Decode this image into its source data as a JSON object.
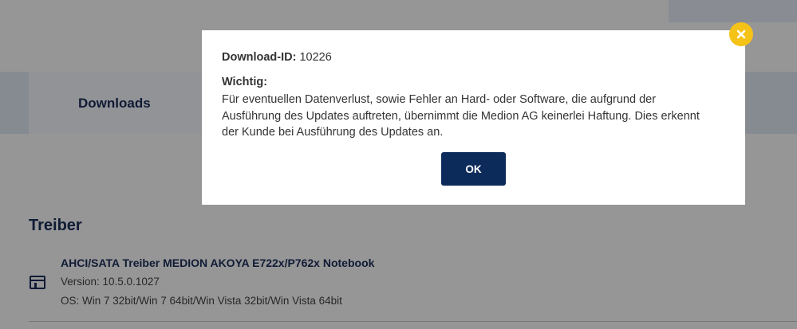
{
  "page": {
    "tab_label": "Downloads",
    "section_title": "Treiber",
    "driver": {
      "title": "AHCI/SATA Treiber MEDION AKOYA E722x/P762x Notebook",
      "version": "Version: 10.5.0.1027",
      "os": "OS: Win 7 32bit/Win 7 64bit/Win Vista 32bit/Win Vista 64bit",
      "icon": "driver-window-icon"
    }
  },
  "modal": {
    "id_label": "Download-ID:",
    "id_value": " 10226",
    "heading": "Wichtig:",
    "body": "Für eventuellen Datenverlust, sowie Fehler an Hard- oder Software, die aufgrund der Ausführung des Updates auftreten, übernimmt die Medion AG keinerlei Haftung. Dies erkennt der Kunde bei Ausführung des Updates an.",
    "ok_label": "OK",
    "close_icon": "close-icon"
  },
  "colors": {
    "brand_navy": "#0d2b5a",
    "close_yellow": "#f5c218",
    "tabs_bar": "#dfe8f3"
  }
}
